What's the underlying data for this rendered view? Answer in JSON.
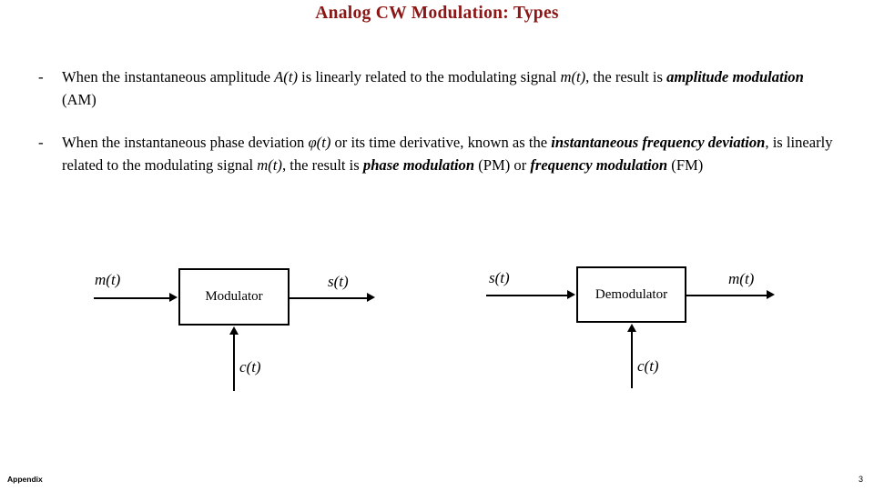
{
  "slide": {
    "title": "Analog CW Modulation: Types",
    "title_color": "#8C1616"
  },
  "bullets": [
    {
      "marker": "-",
      "segments": [
        {
          "text": "When the instantaneous amplitude ",
          "style": "normal"
        },
        {
          "text": "A(t)",
          "style": "math"
        },
        {
          "text": " is linearly related to the modulating signal ",
          "style": "normal"
        },
        {
          "text": "m(t)",
          "style": "math"
        },
        {
          "text": ", the result is ",
          "style": "normal"
        },
        {
          "text": "amplitude modulation",
          "style": "bold-italic"
        },
        {
          "text": " (AM)",
          "style": "normal"
        }
      ]
    },
    {
      "marker": "-",
      "segments": [
        {
          "text": "When the instantaneous phase deviation ",
          "style": "normal"
        },
        {
          "text": "φ(t)",
          "style": "math"
        },
        {
          "text": " or its time derivative, known as the ",
          "style": "normal"
        },
        {
          "text": "instantaneous frequency deviation",
          "style": "bold-italic"
        },
        {
          "text": ", is linearly related to the modulating signal ",
          "style": "normal"
        },
        {
          "text": "m(t)",
          "style": "math"
        },
        {
          "text": ", the result is ",
          "style": "normal"
        },
        {
          "text": "phase modulation",
          "style": "bold-italic"
        },
        {
          "text": " (PM) or ",
          "style": "normal"
        },
        {
          "text": "frequency modulation",
          "style": "bold-italic"
        },
        {
          "text": " (FM)",
          "style": "normal"
        }
      ]
    }
  ],
  "diagrams": {
    "modulator": {
      "block_label": "Modulator",
      "input_label": "m(t)",
      "output_label": "s(t)",
      "carrier_label": "c(t)"
    },
    "demodulator": {
      "block_label": "Demodulator",
      "input_label": "s(t)",
      "output_label": "m(t)",
      "carrier_label": "c(t)"
    }
  },
  "footer": {
    "left": "Appendix",
    "page_number": "3"
  }
}
